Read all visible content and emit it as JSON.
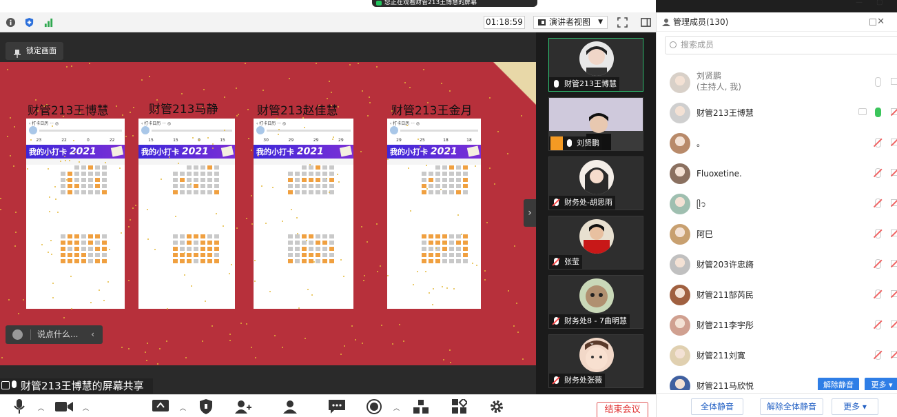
{
  "window": {
    "share_notice": "您正在观看财管213王博慧的屏幕"
  },
  "toolbar": {
    "timer": "01:18:59",
    "view_mode": "演讲者视图"
  },
  "share_area": {
    "lock_label": "锁定画面",
    "chat_placeholder": "说点什么...",
    "sharing_label": "财管213王博慧的屏幕共享",
    "slide": {
      "cards": [
        {
          "name": "财管213王博慧",
          "banner": "我的小打卡",
          "year": "2021"
        },
        {
          "name": "财管213马静",
          "banner": "我的小打卡",
          "year": "2021"
        },
        {
          "name": "财管213赵佳慧",
          "banner": "我的小打卡",
          "year": "2021"
        },
        {
          "name": "财管213王金月",
          "banner": "我的小打卡",
          "year": "2021"
        }
      ]
    }
  },
  "video_tiles": [
    {
      "name": "财管213王博慧",
      "muted": false,
      "active": true
    },
    {
      "name": "刘贤鹏",
      "muted": false,
      "active": false,
      "camera": true
    },
    {
      "name": "财务处-胡思雨",
      "muted": true,
      "active": false
    },
    {
      "name": "张莹",
      "muted": true,
      "active": false
    },
    {
      "name": "财务处8 - 7曲明慧",
      "muted": true,
      "active": false
    },
    {
      "name": "财务处张薇",
      "muted": true,
      "active": false
    }
  ],
  "panel": {
    "title": "管理成员(130)",
    "search_placeholder": "搜索成员",
    "members": [
      {
        "name": "刘贤鹏",
        "role": "(主持人, 我)",
        "avatar_color": "#d8d0c8"
      },
      {
        "name": "财管213王博慧",
        "role": "",
        "avatar_color": "#cfcfcf"
      },
      {
        "name": "。",
        "role": "",
        "avatar_color": "#b88a6a"
      },
      {
        "name": "Fluoxetine.",
        "role": "",
        "avatar_color": "#8a7060"
      },
      {
        "name": "ᥫ᭡",
        "role": "",
        "avatar_color": "#9fbfb0"
      },
      {
        "name": "阿巳",
        "role": "",
        "avatar_color": "#c8a070"
      },
      {
        "name": "财管203许忠旖",
        "role": "",
        "avatar_color": "#c0c0c0"
      },
      {
        "name": "财管211郜芮民",
        "role": "",
        "avatar_color": "#a06040"
      },
      {
        "name": "财管211李宇彤",
        "role": "",
        "avatar_color": "#d0a090"
      },
      {
        "name": "财管211刘寛",
        "role": "",
        "avatar_color": "#e0d0b0"
      },
      {
        "name": "财管211马欣悦",
        "role": "",
        "avatar_color": "#4060a0"
      }
    ],
    "unmute_label": "解除静音",
    "more_label": "更多 ▾",
    "footer": {
      "mute_all": "全体静音",
      "unmute_all": "解除全体静音",
      "more": "更多 ▾"
    }
  },
  "bottombar": {
    "end_label": "结束会议"
  }
}
